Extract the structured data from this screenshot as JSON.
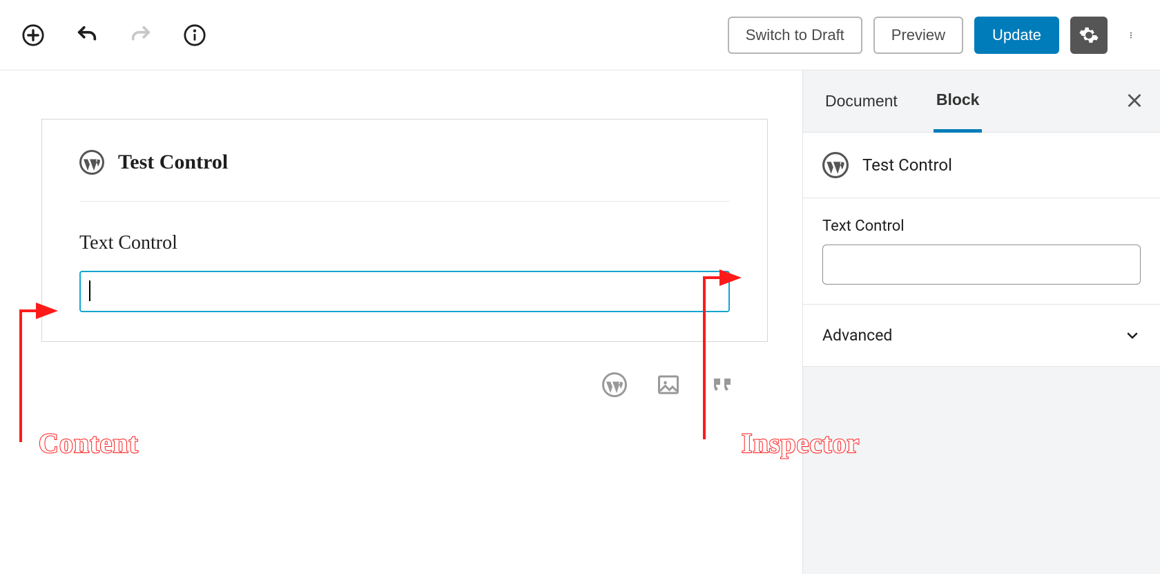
{
  "toolbar": {
    "switch_label": "Switch to Draft",
    "preview_label": "Preview",
    "update_label": "Update"
  },
  "block": {
    "title": "Test Control",
    "field_label": "Text Control",
    "field_value": ""
  },
  "sidebar": {
    "tabs": {
      "document": "Document",
      "block": "Block"
    },
    "block_title": "Test Control",
    "field_label": "Text Control",
    "field_value": "",
    "advanced_label": "Advanced"
  },
  "annotations": {
    "content": "Content",
    "inspector": "Inspector"
  }
}
